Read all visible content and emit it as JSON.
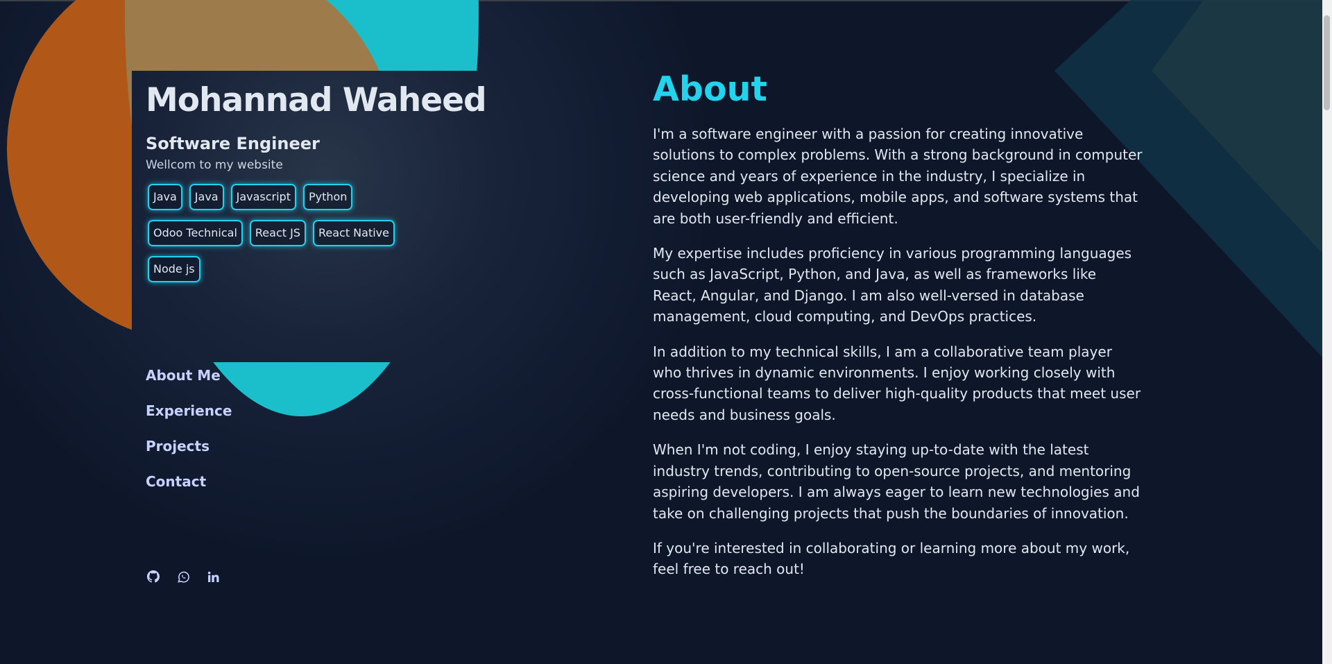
{
  "header": {
    "name": "Mohannad Waheed",
    "role": "Software Engineer",
    "welcome": "Wellcom to my website"
  },
  "skills": [
    "Java",
    "Java",
    "Javascript",
    "Python",
    "Odoo Technical",
    "React JS",
    "React Native",
    "Node js"
  ],
  "nav": {
    "items": [
      {
        "label": "About Me"
      },
      {
        "label": "Experience"
      },
      {
        "label": "Projects"
      },
      {
        "label": "Contact"
      }
    ]
  },
  "social": {
    "icons": [
      "github-icon",
      "whatsapp-icon",
      "linkedin-icon"
    ]
  },
  "about": {
    "title": "About",
    "paragraphs": [
      "I'm a software engineer with a passion for creating innovative solutions to complex problems. With a strong background in computer science and years of experience in the industry, I specialize in developing web applications, mobile apps, and software systems that are both user-friendly and efficient.",
      "My expertise includes proficiency in various programming languages such as JavaScript, Python, and Java, as well as frameworks like React, Angular, and Django. I am also well-versed in database management, cloud computing, and DevOps practices.",
      "In addition to my technical skills, I am a collaborative team player who thrives in dynamic environments. I enjoy working closely with cross-functional teams to deliver high-quality products that meet user needs and business goals.",
      "When I'm not coding, I enjoy staying up-to-date with the latest industry trends, contributing to open-source projects, and mentoring aspiring developers. I am always eager to learn new technologies and take on challenging projects that push the boundaries of innovation.",
      "If you're interested in collaborating or learning more about my work, feel free to reach out!"
    ]
  },
  "colors": {
    "background": "#0e172a",
    "accent": "#22d3ee",
    "nav_text": "#c7d2fe",
    "shape_orange": "#b15818",
    "shape_cyan": "#1bbfcc"
  }
}
